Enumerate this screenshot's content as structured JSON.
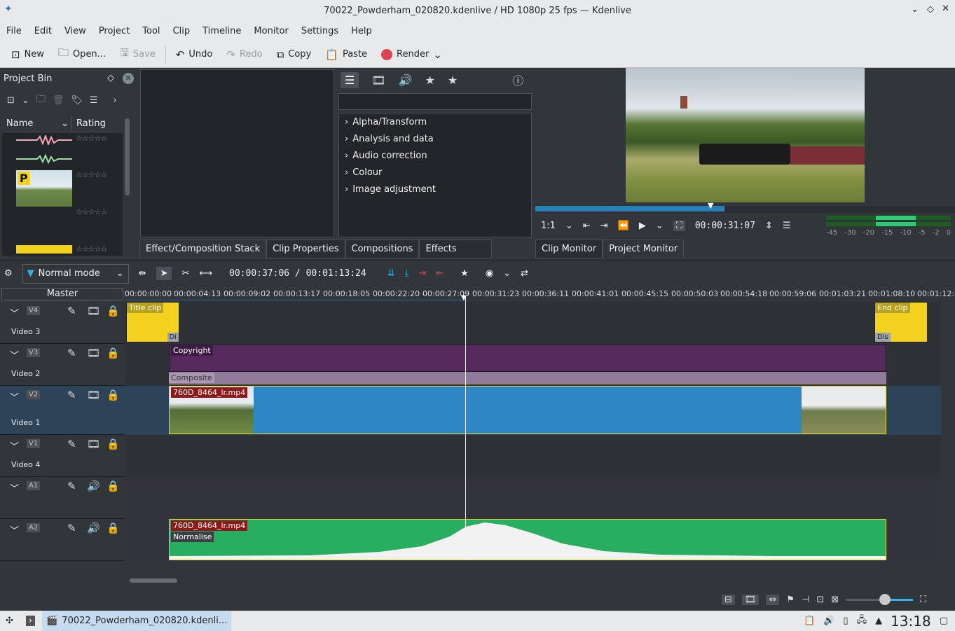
{
  "window": {
    "title": "70022_Powderham_020820.kdenlive / HD 1080p 25 fps — Kdenlive"
  },
  "menu": [
    "File",
    "Edit",
    "View",
    "Project",
    "Tool",
    "Clip",
    "Timeline",
    "Monitor",
    "Settings",
    "Help"
  ],
  "toolbar": {
    "new": "New",
    "open": "Open...",
    "save": "Save",
    "undo": "Undo",
    "redo": "Redo",
    "copy": "Copy",
    "paste": "Paste",
    "render": "Render"
  },
  "project_bin": {
    "title": "Project Bin",
    "col_name": "Name",
    "col_rating": "Rating",
    "thumb_badge": "P"
  },
  "effects": {
    "search_placeholder": "",
    "categories": [
      "Alpha/Transform",
      "Analysis and data",
      "Audio correction",
      "Colour",
      "Image adjustment"
    ]
  },
  "left_tabs": [
    "Effect/Composition Stack",
    "Clip Properties",
    "Compositions",
    "Effects"
  ],
  "monitor": {
    "zoom": "1:1",
    "timecode": "00:00:31:07",
    "tabs": [
      "Clip Monitor",
      "Project Monitor"
    ],
    "meter_scale": [
      "-45",
      "-30",
      "-20",
      "-15",
      "-10",
      "-5",
      "-2",
      "0"
    ],
    "progress": 0.36
  },
  "timeline": {
    "mode": "Normal mode",
    "position": "00:00:37:06 / 00:01:13:24",
    "master": "Master",
    "ruler": [
      "00:00:00:00",
      "00:00:04:13",
      "00:00:09:02",
      "00:00:13:17",
      "00:00:18:05",
      "00:00:22:20",
      "00:00:27:09",
      "00:00:31:23",
      "00:00:36:11",
      "00:00:41:01",
      "00:00:45:15",
      "00:00:50:03",
      "00:00:54:18",
      "00:00:59:06",
      "00:01:03:21",
      "00:01:08:10",
      "00:01:12:2"
    ],
    "tracks": [
      {
        "tag": "V4",
        "name": "Video 3"
      },
      {
        "tag": "V3",
        "name": "Video 2"
      },
      {
        "tag": "V2",
        "name": "Video 1"
      },
      {
        "tag": "V1",
        "name": "Video 4"
      },
      {
        "tag": "A1",
        "name": ""
      },
      {
        "tag": "A2",
        "name": ""
      }
    ],
    "clips": {
      "title": "Title clip",
      "end": "End clip",
      "copyright": "Copyright",
      "composite": "Composite",
      "video": "760D_8464_lr.mp4",
      "audio": "760D_8464_lr.mp4",
      "normalise": "Normalise",
      "dis1": "Di",
      "dis2": "Dis"
    }
  },
  "taskbar": {
    "app": "70022_Powderham_020820.kdenli...",
    "clock": "13:18"
  }
}
